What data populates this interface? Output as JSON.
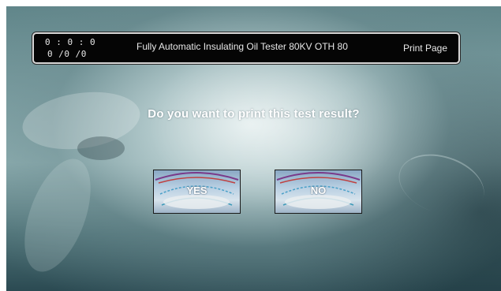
{
  "header": {
    "time": "0 : 0 : 0",
    "date": "0 /0 /0",
    "title": "Fully Automatic Insulating Oil Tester 80KV OTH 80",
    "page_name": "Print Page"
  },
  "dialog": {
    "question": "Do you want to print this test result?"
  },
  "buttons": {
    "yes_label": "YES",
    "no_label": "NO"
  },
  "colors": {
    "header_bg": "#050505",
    "header_border": "#d8d8d8",
    "text": "#ffffff",
    "background_tint": "#7fa2a5"
  }
}
